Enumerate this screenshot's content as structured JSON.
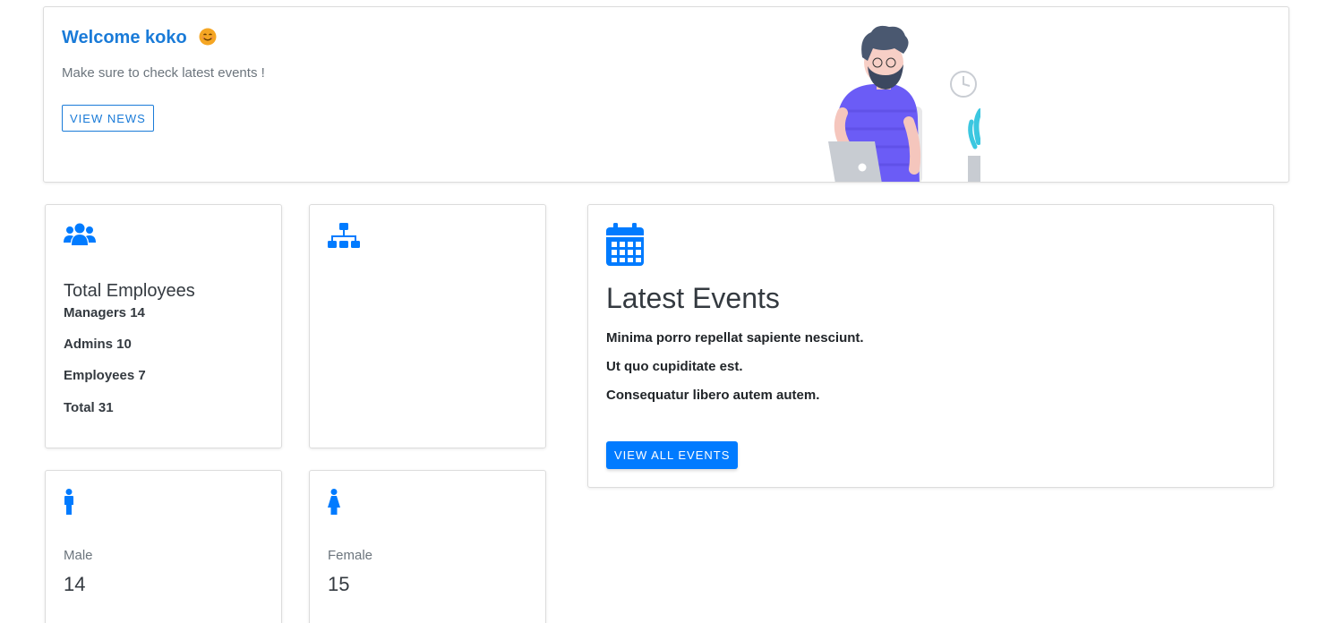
{
  "welcome": {
    "title": "Welcome koko",
    "subtitle": "Make sure to check latest events !",
    "button_label": "VIEW NEWS"
  },
  "employees": {
    "icon": "users-icon",
    "heading": "Total Employees",
    "lines": [
      "Managers 14",
      "Admins 10",
      "Employees 7",
      "Total 31"
    ]
  },
  "org": {
    "icon": "sitemap-icon"
  },
  "male": {
    "icon": "male-icon",
    "label": "Male",
    "value": "14"
  },
  "female": {
    "icon": "female-icon",
    "label": "Female",
    "value": "15"
  },
  "events": {
    "icon": "calendar-icon",
    "heading": "Latest Events",
    "items": [
      "Minima porro repellat sapiente nesciunt.",
      "Ut quo cupiditate est.",
      "Consequatur libero autem autem."
    ],
    "button_label": "VIEW ALL EVENTS"
  },
  "colors": {
    "accent": "#1a7bd8",
    "primary": "#007bff",
    "text": "#343a40",
    "muted": "#6c757d"
  }
}
